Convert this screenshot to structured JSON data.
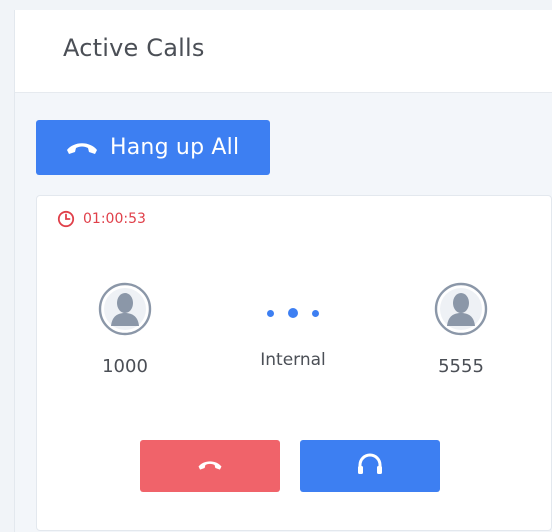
{
  "header": {
    "title": "Active Calls"
  },
  "toolbar": {
    "hangup_all_label": "Hang up All",
    "hangup_all_icon": "phone-hangup-icon"
  },
  "call": {
    "duration": "01:00:53",
    "duration_icon": "clock-icon",
    "caller": {
      "number": "1000",
      "icon": "user-avatar-icon"
    },
    "type": "Internal",
    "connection_icon": "connecting-dots-icon",
    "callee": {
      "number": "5555",
      "icon": "user-avatar-icon"
    },
    "actions": {
      "hangup_icon": "phone-hangup-icon",
      "listen_icon": "headset-icon"
    }
  },
  "colors": {
    "accent": "#3d7ff2",
    "danger": "#f0636a",
    "timer": "#e0404a",
    "text": "#4b4f56"
  }
}
